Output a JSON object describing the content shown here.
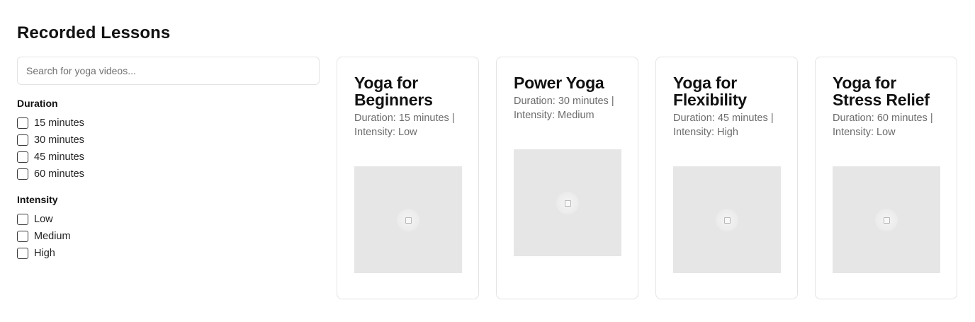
{
  "page": {
    "title": "Recorded Lessons"
  },
  "search": {
    "placeholder": "Search for yoga videos..."
  },
  "filters": {
    "duration": {
      "heading": "Duration",
      "options": [
        "15 minutes",
        "30 minutes",
        "45 minutes",
        "60 minutes"
      ]
    },
    "intensity": {
      "heading": "Intensity",
      "options": [
        "Low",
        "Medium",
        "High"
      ]
    }
  },
  "lessons": [
    {
      "title": "Yoga for Beginners",
      "meta": "Duration: 15 minutes | Intensity: Low",
      "thumbnail_icon": "image-placeholder-icon"
    },
    {
      "title": "Power Yoga",
      "meta": "Duration: 30 minutes | Intensity: Medium",
      "thumbnail_icon": "image-placeholder-icon"
    },
    {
      "title": "Yoga for Flexibility",
      "meta": "Duration: 45 minutes | Intensity: High",
      "thumbnail_icon": "image-placeholder-icon"
    },
    {
      "title": "Yoga for Stress Relief",
      "meta": "Duration: 60 minutes | Intensity: Low",
      "thumbnail_icon": "image-placeholder-icon"
    }
  ],
  "colors": {
    "card_border": "#e4e4e4",
    "thumbnail_bg": "#e6e6e6",
    "meta_text": "#6b6b6b"
  }
}
